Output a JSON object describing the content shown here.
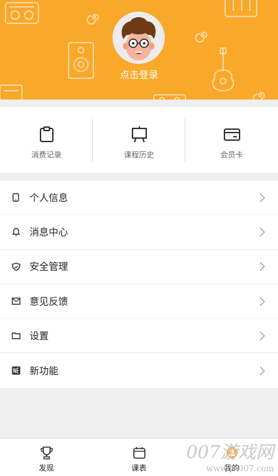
{
  "header": {
    "login_text": "点击登录",
    "background_color": "#f9a82a"
  },
  "quick_actions": [
    {
      "label": "消费记录",
      "icon": "clipboard-icon"
    },
    {
      "label": "课程历史",
      "icon": "easel-board-icon"
    },
    {
      "label": "会员卡",
      "icon": "card-icon"
    }
  ],
  "menu": [
    {
      "label": "个人信息",
      "icon": "phone-icon"
    },
    {
      "label": "消息中心",
      "icon": "bell-icon"
    },
    {
      "label": "安全管理",
      "icon": "shield-icon"
    },
    {
      "label": "意见反馈",
      "icon": "mail-icon"
    },
    {
      "label": "设置",
      "icon": "folder-icon"
    },
    {
      "label": "新功能",
      "icon": "new-badge-icon"
    }
  ],
  "tabbar": [
    {
      "label": "发现",
      "icon": "trophy-icon"
    },
    {
      "label": "课表",
      "icon": "calendar-icon"
    },
    {
      "label": "我的",
      "icon": "profile-icon"
    }
  ],
  "watermark": {
    "big": "007游戏网",
    "small": "www.yx007.com"
  }
}
